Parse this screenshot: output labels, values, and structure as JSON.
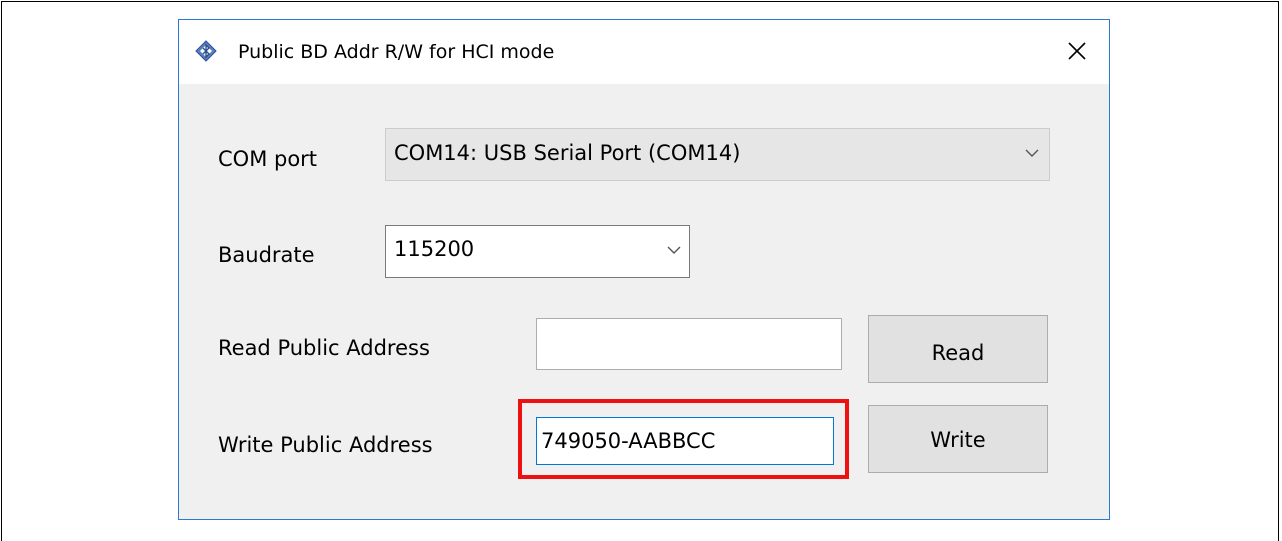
{
  "window": {
    "title": "Public BD Addr R/W for HCI mode",
    "close_icon": "close-icon",
    "app_icon": "bluetooth-diamond-icon"
  },
  "form": {
    "com_port_label": "COM port",
    "com_port_value": "COM14: USB Serial Port (COM14)",
    "baudrate_label": "Baudrate",
    "baudrate_value": "115200",
    "read_label": "Read Public Address",
    "read_value": "",
    "write_label": "Write Public Address",
    "write_value": "749050-AABBCC",
    "read_button": "Read",
    "write_button": "Write"
  },
  "colors": {
    "window_border": "#2b79d7",
    "highlight": "#ee1111",
    "focus_border": "#0078d7"
  }
}
